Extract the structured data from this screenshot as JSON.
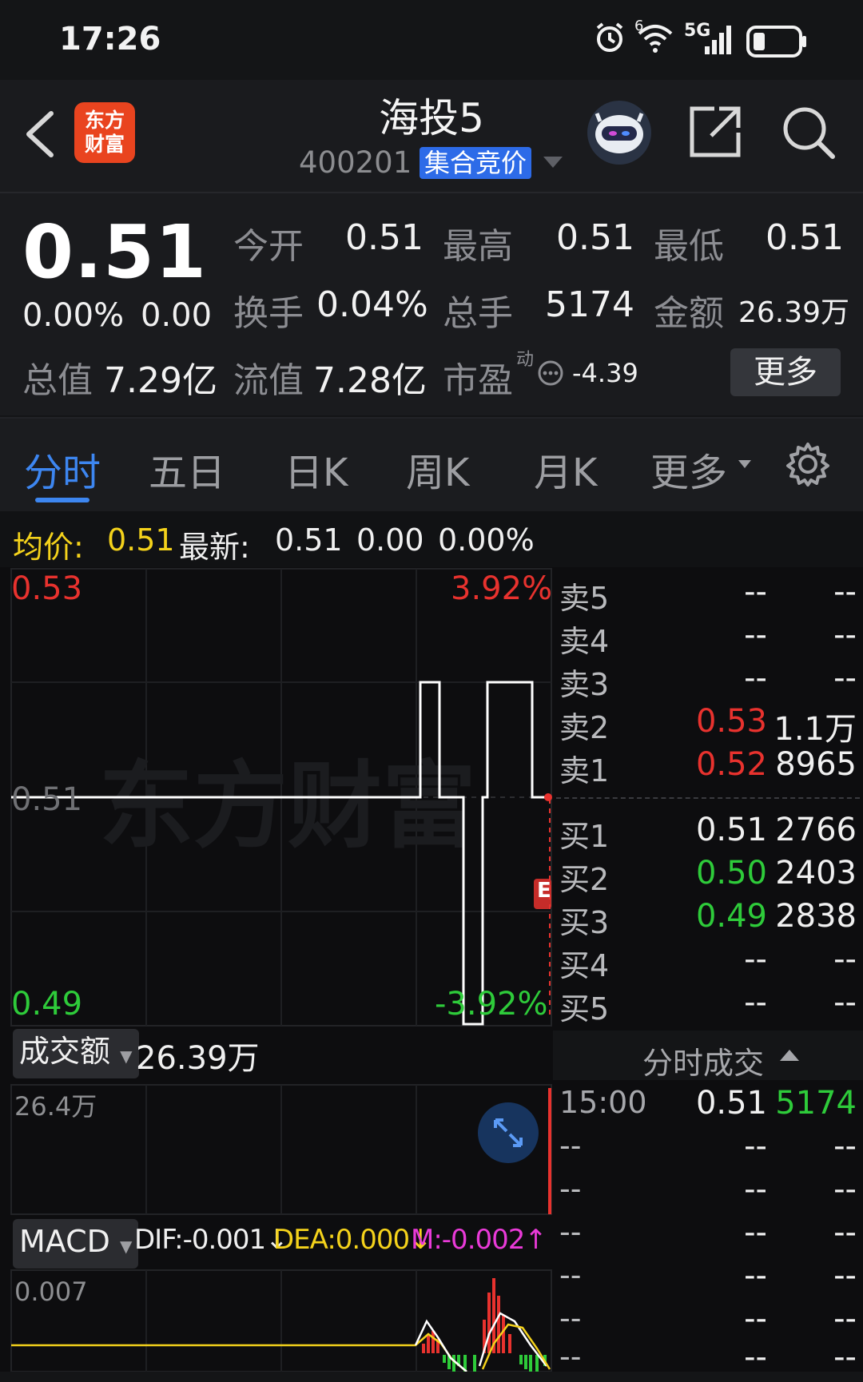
{
  "status_bar": {
    "time": "17:26",
    "network": "5G",
    "signal_badge": "6"
  },
  "header": {
    "title": "海投5",
    "code": "400201",
    "badge": "集合竞价",
    "logo_text_line1": "东方",
    "logo_text_line2": "财富"
  },
  "quote": {
    "price": "0.51",
    "change_pct": "0.00%",
    "change": "0.00",
    "fields": [
      {
        "label": "今开",
        "value": "0.51"
      },
      {
        "label": "最高",
        "value": "0.51"
      },
      {
        "label": "最低",
        "value": "0.51"
      },
      {
        "label": "换手",
        "value": "0.04%"
      },
      {
        "label": "总手",
        "value": "5174"
      },
      {
        "label": "金额",
        "value": "26.39万"
      },
      {
        "label": "总值",
        "value": "7.29亿"
      },
      {
        "label": "流值",
        "value": "7.28亿"
      },
      {
        "label": "市盈",
        "sup": "动",
        "value": "-4.39"
      }
    ],
    "more_button": "更多"
  },
  "tabs": [
    {
      "label": "分时",
      "active": true
    },
    {
      "label": "五日"
    },
    {
      "label": "日K"
    },
    {
      "label": "周K"
    },
    {
      "label": "月K"
    },
    {
      "label": "更多"
    }
  ],
  "info_bar": {
    "avg_label": "均价:",
    "avg_value": "0.51",
    "latest_label": "最新:",
    "latest_value": "0.51",
    "change": "0.00",
    "change_pct": "0.00%"
  },
  "chart_data": {
    "type": "line",
    "price_axis": {
      "high": "0.53",
      "mid": "0.51",
      "low": "0.49"
    },
    "pct_axis": {
      "high": "3.92%",
      "low": "-3.92%"
    },
    "watermark": "东方财富",
    "e_marker": "E",
    "colors": {
      "up": "#e8322e",
      "down": "#2ecb3a",
      "line": "#ffffff",
      "avg": "#f4d21b",
      "macd_m": "#e93ad8"
    }
  },
  "volume_panel": {
    "selector": "成交额",
    "value": "26.39万",
    "axis_max": "26.4万"
  },
  "macd_panel": {
    "selector": "MACD",
    "dif": "DIF:-0.001",
    "dea": "DEA:0.000",
    "m": "M:-0.002",
    "axis_max": "0.007"
  },
  "order_book": {
    "asks": [
      {
        "label": "卖5",
        "price": "--",
        "vol": "--"
      },
      {
        "label": "卖4",
        "price": "--",
        "vol": "--"
      },
      {
        "label": "卖3",
        "price": "--",
        "vol": "--"
      },
      {
        "label": "卖2",
        "price": "0.53",
        "vol": "1.1万"
      },
      {
        "label": "卖1",
        "price": "0.52",
        "vol": "8965"
      }
    ],
    "bids": [
      {
        "label": "买1",
        "price": "0.51",
        "vol": "2766"
      },
      {
        "label": "买2",
        "price": "0.50",
        "vol": "2403"
      },
      {
        "label": "买3",
        "price": "0.49",
        "vol": "2838"
      },
      {
        "label": "买4",
        "price": "--",
        "vol": "--"
      },
      {
        "label": "买5",
        "price": "--",
        "vol": "--"
      }
    ]
  },
  "trades": {
    "header": "分时成交",
    "rows": [
      {
        "time": "15:00",
        "price": "0.51",
        "vol": "5174"
      },
      {
        "time": "--",
        "price": "--",
        "vol": "--"
      },
      {
        "time": "--",
        "price": "--",
        "vol": "--"
      },
      {
        "time": "--",
        "price": "--",
        "vol": "--"
      },
      {
        "time": "--",
        "price": "--",
        "vol": "--"
      },
      {
        "time": "--",
        "price": "--",
        "vol": "--"
      },
      {
        "time": "--",
        "price": "--",
        "vol": "--"
      }
    ]
  }
}
